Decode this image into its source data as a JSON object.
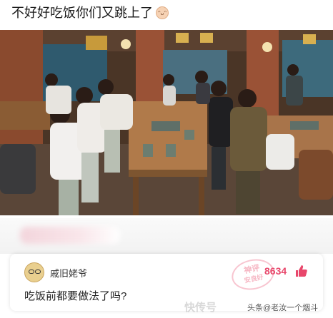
{
  "post": {
    "title": "不好好吃饭你们又跳上了"
  },
  "photo": {
    "description_icon": "restaurant-dance-photo"
  },
  "comment": {
    "username": "戚旧姥爷",
    "like_count": "8634",
    "text": "吃饭前都要做法了吗?",
    "stamp_line1": "神评",
    "stamp_line2": "安良好"
  },
  "watermark": {
    "left": "快传号",
    "right": "头条@老汝一个烟斗"
  },
  "colors": {
    "like": "#e8476b",
    "stamp": "#ec5a78"
  }
}
